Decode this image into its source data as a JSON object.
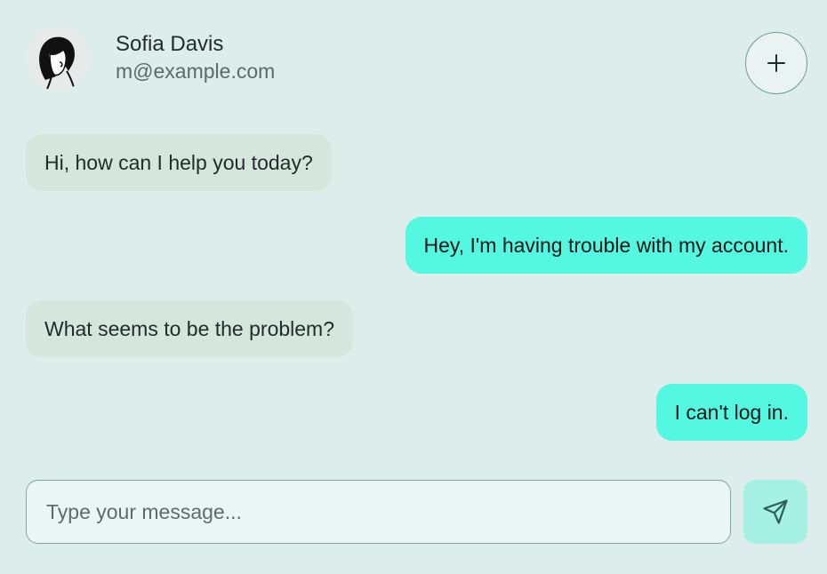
{
  "contact": {
    "name": "Sofia Davis",
    "email": "m@example.com",
    "avatar_icon": "avatar-portrait-icon"
  },
  "header": {
    "new_chat_icon": "plus-icon"
  },
  "messages": [
    {
      "from": "agent",
      "text": "Hi, how can I help you today?"
    },
    {
      "from": "user",
      "text": "Hey, I'm having trouble with my account."
    },
    {
      "from": "agent",
      "text": "What seems to be the problem?"
    },
    {
      "from": "user",
      "text": "I can't log in."
    }
  ],
  "composer": {
    "placeholder": "Type your message...",
    "value": "",
    "send_icon": "send-icon"
  },
  "colors": {
    "background": "#dcedeb",
    "agent_bubble": "#d5e7dd",
    "user_bubble": "#54f7e0",
    "send_button": "#a5f2e4"
  }
}
